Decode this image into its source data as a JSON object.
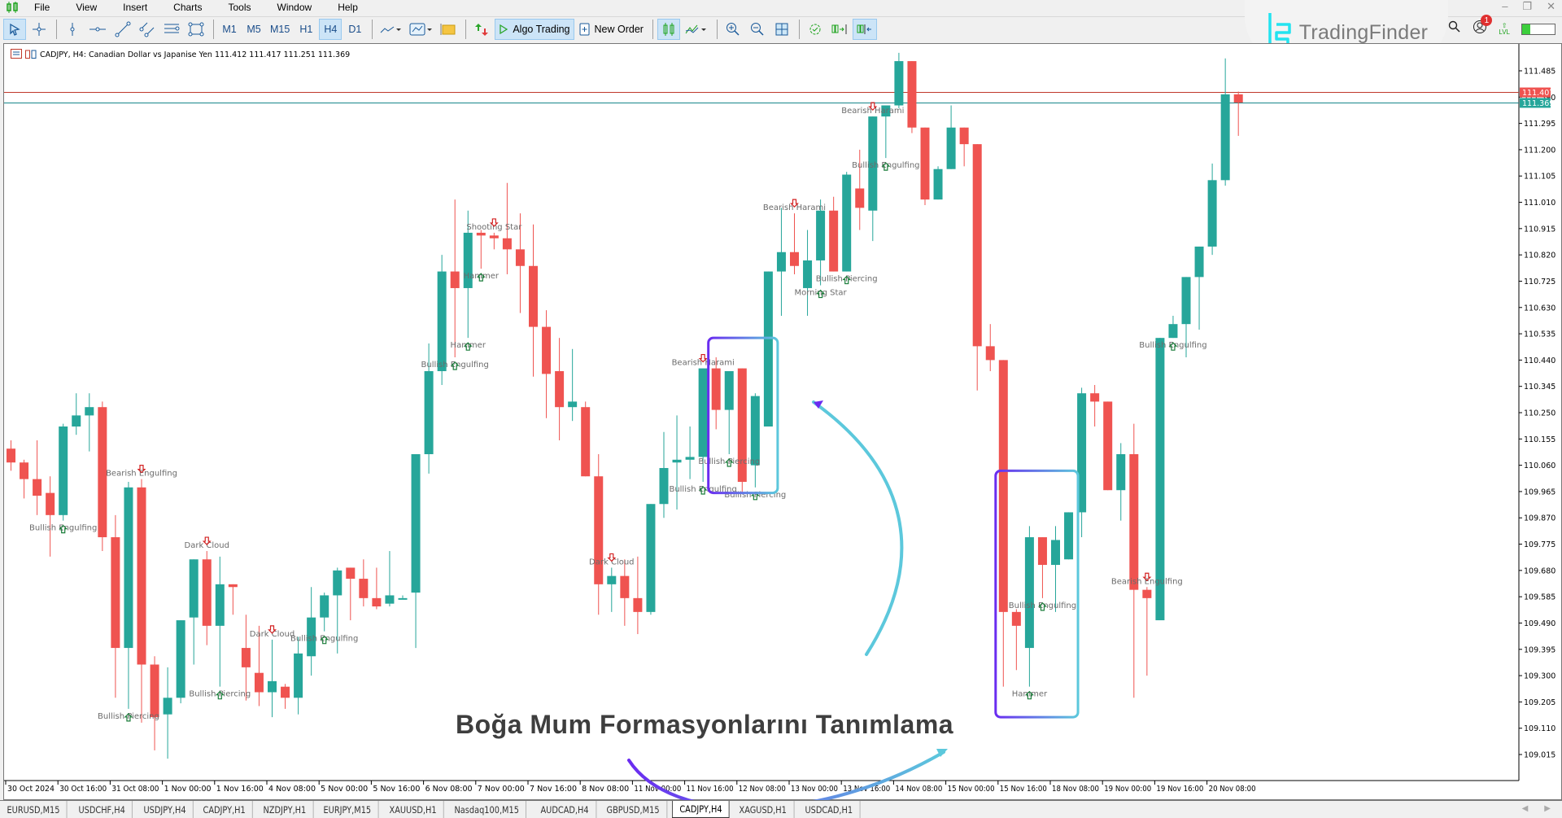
{
  "menu": {
    "items": [
      "File",
      "View",
      "Insert",
      "Charts",
      "Tools",
      "Window",
      "Help"
    ]
  },
  "window_controls": [
    "minimize",
    "restore",
    "close"
  ],
  "toolbar": {
    "timeframes": [
      "M1",
      "M5",
      "M15",
      "H1",
      "H4",
      "D1"
    ],
    "active_timeframe": "H4",
    "algo_trading_label": "Algo Trading",
    "new_order_label": "New Order"
  },
  "branding": {
    "logo_text": "TradingFinder"
  },
  "status": {
    "notifications_count": "1",
    "lvl_label": "LVL",
    "lvl_fill": 0.25
  },
  "chart": {
    "symbol_line": "CADJPY, H4:  Canadian Dollar vs Japanise Yen  111.412 111.417 111.251 111.369",
    "ask_price": "111.407",
    "bid_price": "111.369",
    "overlay_title": "Boğa Mum Formasyonlarını Tanımlama",
    "colors": {
      "bull": "#26a69a",
      "bear": "#ef5350",
      "ask_line": "#c0392b",
      "bid_line": "#16868a",
      "label": "#6b6b6b",
      "highlight_start": "#6a2cf0",
      "highlight_end": "#5cc8dc"
    }
  },
  "chart_data": {
    "type": "candlestick",
    "title": "CADJPY, H4",
    "ylim": [
      108.92,
      111.58
    ],
    "y_ticks": [
      "111.485",
      "111.390",
      "111.295",
      "111.200",
      "111.105",
      "111.010",
      "110.915",
      "110.820",
      "110.725",
      "110.630",
      "110.535",
      "110.440",
      "110.345",
      "110.250",
      "110.155",
      "110.060",
      "109.965",
      "109.870",
      "109.775",
      "109.680",
      "109.585",
      "109.490",
      "109.395",
      "109.300",
      "109.205",
      "109.110",
      "109.015"
    ],
    "x_ticks": [
      "30 Oct 2024",
      "30 Oct 16:00",
      "31 Oct 08:00",
      "1 Nov 00:00",
      "1 Nov 16:00",
      "4 Nov 08:00",
      "5 Nov 00:00",
      "5 Nov 16:00",
      "6 Nov 08:00",
      "7 Nov 00:00",
      "7 Nov 16:00",
      "8 Nov 08:00",
      "11 Nov 00:00",
      "11 Nov 16:00",
      "12 Nov 08:00",
      "13 Nov 00:00",
      "13 Nov 16:00",
      "14 Nov 08:00",
      "15 Nov 00:00",
      "15 Nov 16:00",
      "18 Nov 08:00",
      "19 Nov 00:00",
      "19 Nov 16:00",
      "20 Nov 08:00"
    ],
    "candles": [
      [
        110.12,
        110.15,
        110.04,
        110.07
      ],
      [
        110.07,
        110.08,
        109.94,
        110.01
      ],
      [
        110.01,
        110.15,
        109.88,
        109.95
      ],
      [
        109.96,
        110.02,
        109.73,
        109.88
      ],
      [
        109.88,
        110.21,
        109.86,
        110.2
      ],
      [
        110.2,
        110.32,
        110.17,
        110.24
      ],
      [
        110.24,
        110.32,
        110.11,
        110.27
      ],
      [
        110.27,
        110.29,
        109.75,
        109.8
      ],
      [
        109.8,
        109.88,
        109.22,
        109.4
      ],
      [
        109.4,
        110.0,
        109.18,
        109.98
      ],
      [
        109.98,
        110.01,
        109.13,
        109.34
      ],
      [
        109.34,
        109.37,
        109.03,
        109.15
      ],
      [
        109.16,
        109.33,
        109.0,
        109.22
      ],
      [
        109.22,
        109.42,
        109.2,
        109.5
      ],
      [
        109.51,
        109.7,
        109.34,
        109.72
      ],
      [
        109.72,
        109.75,
        109.41,
        109.48
      ],
      [
        109.48,
        109.73,
        109.26,
        109.63
      ],
      [
        109.63,
        109.6,
        109.52,
        109.62
      ],
      [
        109.4,
        109.52,
        109.21,
        109.33
      ],
      [
        109.31,
        109.48,
        109.19,
        109.24
      ],
      [
        109.24,
        109.43,
        109.15,
        109.28
      ],
      [
        109.26,
        109.27,
        109.18,
        109.22
      ],
      [
        109.22,
        109.44,
        109.16,
        109.38
      ],
      [
        109.37,
        109.62,
        109.3,
        109.51
      ],
      [
        109.51,
        109.6,
        109.46,
        109.59
      ],
      [
        109.59,
        109.69,
        109.38,
        109.68
      ],
      [
        109.69,
        109.65,
        109.5,
        109.65
      ],
      [
        109.65,
        109.72,
        109.55,
        109.58
      ],
      [
        109.58,
        109.69,
        109.54,
        109.55
      ],
      [
        109.56,
        109.75,
        109.55,
        109.59
      ],
      [
        109.58,
        109.59,
        109.58,
        109.58
      ],
      [
        109.6,
        109.99,
        109.4,
        110.1
      ],
      [
        110.1,
        110.5,
        110.03,
        110.4
      ],
      [
        110.4,
        110.82,
        110.35,
        110.76
      ],
      [
        110.76,
        111.02,
        110.45,
        110.7
      ],
      [
        110.7,
        110.98,
        110.52,
        110.9
      ],
      [
        110.9,
        110.91,
        110.77,
        110.89
      ],
      [
        110.89,
        110.9,
        110.84,
        110.88
      ],
      [
        110.88,
        111.08,
        110.75,
        110.84
      ],
      [
        110.84,
        110.97,
        110.61,
        110.78
      ],
      [
        110.78,
        110.93,
        110.38,
        110.56
      ],
      [
        110.56,
        110.62,
        110.23,
        110.39
      ],
      [
        110.4,
        110.52,
        110.15,
        110.27
      ],
      [
        110.27,
        110.48,
        110.22,
        110.29
      ],
      [
        110.27,
        110.29,
        110.04,
        110.02
      ],
      [
        110.02,
        110.1,
        109.52,
        109.63
      ],
      [
        109.63,
        109.69,
        109.53,
        109.66
      ],
      [
        109.66,
        109.72,
        109.48,
        109.58
      ],
      [
        109.58,
        109.73,
        109.45,
        109.53
      ],
      [
        109.53,
        109.91,
        109.52,
        109.92
      ],
      [
        109.92,
        110.18,
        109.87,
        110.05
      ],
      [
        110.07,
        110.24,
        109.9,
        110.08
      ],
      [
        110.08,
        110.2,
        110.01,
        110.09
      ],
      [
        110.09,
        110.38,
        110.0,
        110.41
      ],
      [
        110.41,
        110.45,
        110.19,
        110.26
      ],
      [
        110.26,
        110.4,
        110.1,
        110.4
      ],
      [
        110.41,
        110.38,
        109.96,
        110.0
      ],
      [
        110.06,
        110.32,
        109.98,
        110.31
      ],
      [
        110.2,
        110.76,
        110.21,
        110.76
      ],
      [
        110.76,
        110.99,
        110.6,
        110.83
      ],
      [
        110.83,
        110.97,
        110.75,
        110.78
      ],
      [
        110.7,
        110.91,
        110.6,
        110.8
      ],
      [
        110.8,
        111.02,
        110.71,
        110.98
      ],
      [
        110.98,
        111.03,
        110.81,
        110.76
      ],
      [
        110.76,
        111.12,
        110.76,
        111.11
      ],
      [
        111.06,
        111.2,
        110.91,
        110.99
      ],
      [
        110.98,
        111.32,
        110.87,
        111.32
      ],
      [
        111.32,
        111.36,
        111.17,
        111.36
      ],
      [
        111.36,
        111.55,
        111.35,
        111.52
      ],
      [
        111.52,
        111.51,
        111.26,
        111.28
      ],
      [
        111.28,
        111.25,
        111.0,
        111.02
      ],
      [
        111.02,
        111.14,
        111.02,
        111.13
      ],
      [
        111.13,
        111.36,
        111.17,
        111.28
      ],
      [
        111.28,
        111.27,
        111.14,
        111.22
      ],
      [
        111.22,
        111.2,
        110.33,
        110.49
      ],
      [
        110.49,
        110.57,
        110.4,
        110.44
      ],
      [
        110.44,
        110.44,
        109.26,
        109.53
      ],
      [
        109.53,
        109.54,
        109.32,
        109.48
      ],
      [
        109.4,
        109.84,
        109.26,
        109.8
      ],
      [
        109.8,
        109.8,
        109.58,
        109.7
      ],
      [
        109.7,
        109.84,
        109.53,
        109.79
      ],
      [
        109.72,
        109.87,
        109.72,
        109.89
      ],
      [
        109.89,
        110.34,
        109.8,
        110.32
      ],
      [
        110.32,
        110.35,
        110.2,
        110.29
      ],
      [
        110.29,
        110.27,
        109.97,
        109.97
      ],
      [
        109.97,
        110.14,
        109.86,
        110.1
      ],
      [
        110.1,
        110.21,
        109.22,
        109.61
      ],
      [
        109.61,
        109.62,
        109.3,
        109.58
      ],
      [
        109.5,
        110.35,
        109.54,
        110.52
      ],
      [
        110.52,
        110.6,
        110.55,
        110.57
      ],
      [
        110.57,
        110.66,
        110.45,
        110.74
      ],
      [
        110.74,
        110.73,
        110.55,
        110.85
      ],
      [
        110.85,
        111.15,
        110.82,
        111.09
      ],
      [
        111.09,
        111.53,
        111.07,
        111.4
      ],
      [
        111.4,
        111.41,
        111.25,
        111.37
      ]
    ],
    "patterns": [
      {
        "label": "Bearish Engulfing",
        "candle": 10,
        "dir": "bear"
      },
      {
        "label": "Bullish Engulfing",
        "candle": 4,
        "dir": "bull"
      },
      {
        "label": "Dark Cloud",
        "candle": 15,
        "dir": "bear"
      },
      {
        "label": "Dark Cloud",
        "candle": 20,
        "dir": "bear"
      },
      {
        "label": "Bullish Piercing",
        "candle": 9,
        "dir": "bull"
      },
      {
        "label": "Bullish Piercing",
        "candle": 16,
        "dir": "bull"
      },
      {
        "label": "Bullish Engulfing",
        "candle": 24,
        "dir": "bull"
      },
      {
        "label": "Shooting Star",
        "candle": 37,
        "dir": "bear"
      },
      {
        "label": "Hammer",
        "candle": 35,
        "dir": "bull"
      },
      {
        "label": "Hammer",
        "candle": 36,
        "dir": "bull"
      },
      {
        "label": "Bullish Engulfing",
        "candle": 34,
        "dir": "bull"
      },
      {
        "label": "Dark Cloud",
        "candle": 46,
        "dir": "bear"
      },
      {
        "label": "Bullish Engulfing",
        "candle": 53,
        "dir": "bull"
      },
      {
        "label": "Bearish Harami",
        "candle": 53,
        "dir": "bear"
      },
      {
        "label": "Bullish Piercing",
        "candle": 55,
        "dir": "bull"
      },
      {
        "label": "Bullish Piercing",
        "candle": 57,
        "dir": "bull"
      },
      {
        "label": "Bearish Harami",
        "candle": 60,
        "dir": "bear"
      },
      {
        "label": "Morning Star",
        "candle": 62,
        "dir": "bull"
      },
      {
        "label": "Bullish Piercing",
        "candle": 64,
        "dir": "bull"
      },
      {
        "label": "Bullish Engulfing",
        "candle": 67,
        "dir": "bull"
      },
      {
        "label": "Bearish Harami",
        "candle": 66,
        "dir": "bear"
      },
      {
        "label": "Hammer",
        "candle": 78,
        "dir": "bull"
      },
      {
        "label": "Bullish Engulfing",
        "candle": 79,
        "dir": "bull"
      },
      {
        "label": "Bearish Engulfing",
        "candle": 87,
        "dir": "bear"
      },
      {
        "label": "Bullish Engulfing",
        "candle": 89,
        "dir": "bull"
      }
    ],
    "highlights": [
      {
        "from_candle": 54,
        "to_candle": 58,
        "top": 110.52,
        "bottom": 109.96
      },
      {
        "from_candle": 76,
        "to_candle": 81,
        "top": 110.04,
        "bottom": 109.15
      }
    ]
  },
  "tabs": [
    "EURUSD,M15",
    "USDCHF,H4",
    "USDJPY,H4",
    "CADJPY,H1",
    "NZDJPY,H1",
    "EURJPY,M15",
    "XAUUSD,H1",
    "Nasdaq100,M15",
    "AUDCAD,H4",
    "GBPUSD,M15",
    "CADJPY,H4",
    "XAGUSD,H1",
    "USDCAD,H1"
  ],
  "active_tab": "CADJPY,H4"
}
